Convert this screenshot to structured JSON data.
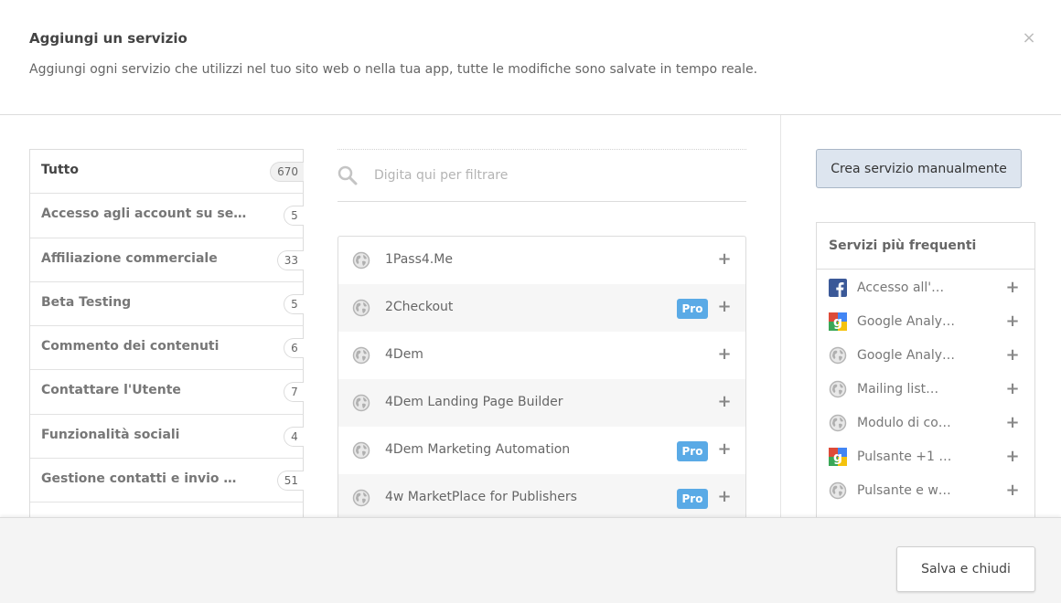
{
  "header": {
    "title": "Aggiungi un servizio",
    "subtitle": "Aggiungi ogni servizio che utilizzi nel tuo sito web o nella tua app, tutte le modifiche sono salvate in tempo reale.",
    "close_glyph": "×"
  },
  "categories": [
    {
      "label": "Tutto",
      "count": "670",
      "active": true
    },
    {
      "label": "Accesso agli account su se…",
      "count": "5"
    },
    {
      "label": "Affiliazione commerciale",
      "count": "33"
    },
    {
      "label": "Beta Testing",
      "count": "5"
    },
    {
      "label": "Commento dei contenuti",
      "count": "6"
    },
    {
      "label": "Contattare l'Utente",
      "count": "7"
    },
    {
      "label": "Funzionalità sociali",
      "count": "4"
    },
    {
      "label": "Gestione contatti e invio …",
      "count": "51"
    },
    {
      "label": "",
      "count": ""
    }
  ],
  "search": {
    "placeholder": "Digita qui per filtrare",
    "icon": "search-icon"
  },
  "services": [
    {
      "name": "1Pass4.Me",
      "pro": false,
      "icon": "globe-icon"
    },
    {
      "name": "2Checkout",
      "pro": true,
      "icon": "globe-icon"
    },
    {
      "name": "4Dem",
      "pro": false,
      "icon": "globe-icon"
    },
    {
      "name": "4Dem Landing Page Builder",
      "pro": false,
      "icon": "globe-icon"
    },
    {
      "name": "4Dem Marketing Automation",
      "pro": true,
      "icon": "globe-icon"
    },
    {
      "name": "4w MarketPlace for Publishers",
      "pro": true,
      "icon": "globe-icon"
    }
  ],
  "pro_label": "Pro",
  "add_glyph": "+",
  "right": {
    "create_label": "Crea servizio manualmente",
    "frequent_title": "Servizi più frequenti",
    "frequent": [
      {
        "name": "Accesso all'…",
        "icon": "facebook-icon"
      },
      {
        "name": "Google Analy…",
        "icon": "google-icon"
      },
      {
        "name": "Google Analy…",
        "icon": "globe-icon"
      },
      {
        "name": "Mailing list…",
        "icon": "globe-icon"
      },
      {
        "name": "Modulo di co…",
        "icon": "globe-icon"
      },
      {
        "name": "Pulsante +1 …",
        "icon": "google-icon"
      },
      {
        "name": "Pulsante e w…",
        "icon": "globe-icon"
      }
    ]
  },
  "footer": {
    "save_label": "Salva e chiudi"
  },
  "colors": {
    "pro_badge": "#5aaae6",
    "create_button_bg": "#dde5ef",
    "facebook_blue": "#3b5998",
    "google_red": "#dd4b39",
    "google_green": "#3aa757",
    "google_yellow": "#f4c20d",
    "google_blue": "#4285f4"
  }
}
